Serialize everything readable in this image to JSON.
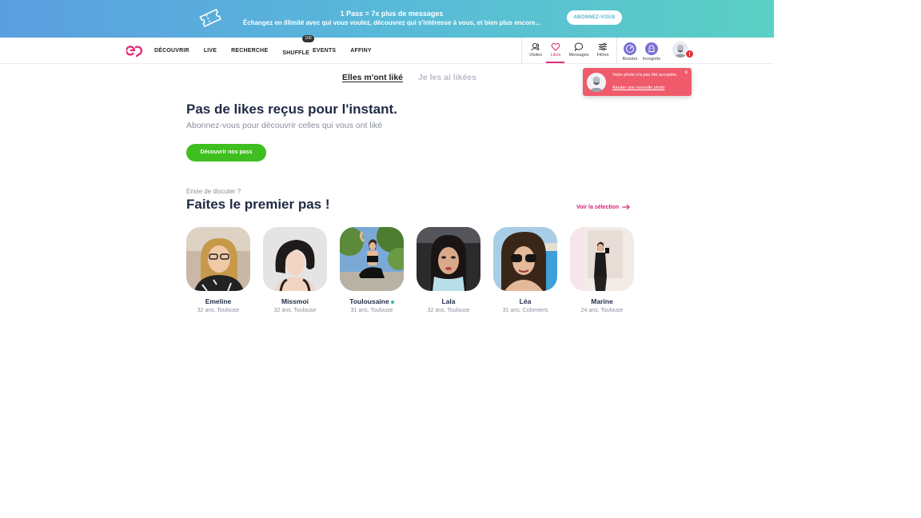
{
  "promo": {
    "title": "1 Pass = 7x plus de messages",
    "subtitle": "Échangez en illimité avec qui vous voulez, découvrez qui s'intéresse à vous, et bien plus encore...",
    "button": "ABONNEZ-VOUS"
  },
  "nav": {
    "links": [
      "DÉCOUVRIR",
      "LIVE",
      "RECHERCHE",
      "SHUFFLE",
      "EVENTS",
      "AFFINY"
    ],
    "shuffle_badge": "100",
    "icons": [
      {
        "label": "Visites",
        "icon": "visits-icon"
      },
      {
        "label": "Likes",
        "icon": "heart-icon",
        "active": true
      },
      {
        "label": "Messages",
        "icon": "message-icon"
      },
      {
        "label": "Filtres",
        "icon": "filters-icon"
      },
      {
        "label": "Booster",
        "icon": "booster-icon"
      },
      {
        "label": "Incognito",
        "icon": "incognito-icon"
      }
    ],
    "alert_badge": "!"
  },
  "toast": {
    "message": "Votre photo n'a pas été acceptée",
    "link": "Ajouter une nouvelle photo",
    "close": "×"
  },
  "tabs": {
    "received": "Elles m'ont liké",
    "sent": "Je les ai likées"
  },
  "empty": {
    "title": "Pas de likes reçus pour l'instant.",
    "subtitle": "Abonnez-vous pour découvrir celles qui vous ont liké",
    "button": "Découvrir nos pass"
  },
  "section": {
    "pretitle": "Envie de discuter ?",
    "title": "Faites le premier pas !",
    "link": "Voir la sélection"
  },
  "profiles": [
    {
      "name": "Emeline",
      "meta": "32 ans, Toulouse",
      "online": false
    },
    {
      "name": "Missmoi",
      "meta": "32 ans, Toulouse",
      "online": false
    },
    {
      "name": "Toulousaine",
      "meta": "31 ans, Toulouse",
      "online": true
    },
    {
      "name": "Lala",
      "meta": "32 ans, Toulouse",
      "online": false
    },
    {
      "name": "Léa",
      "meta": "31 ans, Colomiers",
      "online": false
    },
    {
      "name": "Marine",
      "meta": "24 ans, Toulouse",
      "online": false
    }
  ],
  "colors": {
    "accent": "#e0307a",
    "cta": "#3fbe1f",
    "toast": "#ef5b6b",
    "online": "#2cc58a"
  }
}
